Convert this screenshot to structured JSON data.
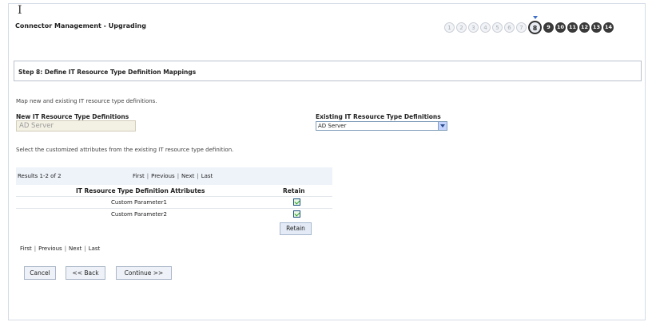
{
  "page": {
    "title": "Connector Management - Upgrading",
    "cursor": "I"
  },
  "steps": {
    "done": [
      "1",
      "2",
      "3",
      "4",
      "5",
      "6",
      "7"
    ],
    "current": "8",
    "todo": [
      "9",
      "10",
      "11",
      "12",
      "13",
      "14"
    ]
  },
  "section": {
    "heading": "Step 8: Define IT Resource Type Definition Mappings",
    "description": "Map new and existing IT resource type definitions.",
    "new_label": "New IT Resource Type Definitions",
    "new_value": "AD Server",
    "existing_label": "Existing IT Resource Type Definitions",
    "existing_value": "AD Server",
    "instructions": "Select the customized attributes from the existing IT resource type definition."
  },
  "table": {
    "results": "Results 1-2 of 2",
    "nav": {
      "first": "First",
      "previous": "Previous",
      "next": "Next",
      "last": "Last",
      "separator": "|"
    },
    "headers": {
      "attributes": "IT Resource Type Definition Attributes",
      "retain": "Retain"
    },
    "rows": [
      {
        "name": "Custom Parameter1",
        "retained": true
      },
      {
        "name": "Custom Parameter2",
        "retained": true
      }
    ],
    "retain_button": "Retain"
  },
  "buttons": {
    "cancel": "Cancel",
    "back": "<< Back",
    "continue": "Continue >>"
  },
  "colors": {
    "current_step_marker": "#3f6fc7",
    "todo_step": "#3a3a3a",
    "checkbox_check": "#21a121"
  }
}
